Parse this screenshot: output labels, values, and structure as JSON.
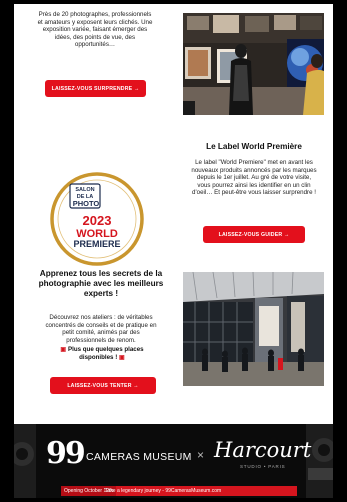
{
  "top_left": {
    "text": "Près de 20 photographes, professionnels et amateurs y exposent leurs clichés. Une exposition variée, faisant émerger des idées, des points de vue, des opportunités…",
    "button": "LAISSEZ-VOUS SURPRENDRE →"
  },
  "label": {
    "logo_line1": "SALON",
    "logo_line2": "DE LA",
    "logo_line3": "PHOTO",
    "logo_year": "2023",
    "logo_world": "WORLD",
    "logo_premiere": "PREMIERE",
    "title": "Le Label World Première",
    "text": "Le label \"World Premiere\" met en avant les nouveaux produits annoncés par les marques depuis le 1er juillet. Au gré de votre visite, vous pourrez ainsi les identifier en un clin d'oeil… Et peut-être vous laisser surprendre !",
    "button": "LAISSEZ-VOUS GUIDER →"
  },
  "workshops": {
    "title": "Apprenez tous les secrets de la photographie avec les meilleurs experts !",
    "text": "Découvrez nos ateliers : de véritables concentrés de conseils et de pratique en petit comité, animés par des professionnels de renom.",
    "alert": "Plus que quelques places disponibles !",
    "button": "LAISSEZ-VOUS TENTER →"
  },
  "banner": {
    "number": "99",
    "museum": "CAMERAS MUSEUM",
    "times": "×",
    "partner": "Harcourt",
    "partner_sub": "STUDIO • PARIS",
    "opening": "Opening October 12th",
    "tagline": "Take a legendary journey - 99CamerasMuseum.com"
  },
  "colors": {
    "accent": "#e3101c",
    "gold": "#c9962e",
    "navy": "#1c2b4d"
  }
}
